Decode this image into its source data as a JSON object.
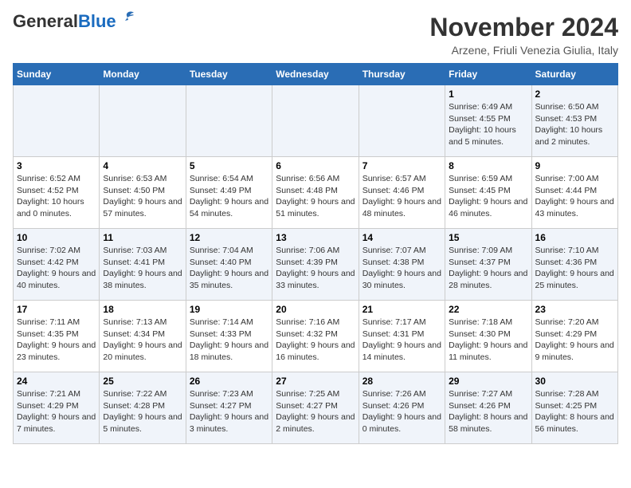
{
  "header": {
    "logo_general": "General",
    "logo_blue": "Blue",
    "month_title": "November 2024",
    "location": "Arzene, Friuli Venezia Giulia, Italy"
  },
  "days_of_week": [
    "Sunday",
    "Monday",
    "Tuesday",
    "Wednesday",
    "Thursday",
    "Friday",
    "Saturday"
  ],
  "weeks": [
    [
      {
        "day": "",
        "info": ""
      },
      {
        "day": "",
        "info": ""
      },
      {
        "day": "",
        "info": ""
      },
      {
        "day": "",
        "info": ""
      },
      {
        "day": "",
        "info": ""
      },
      {
        "day": "1",
        "info": "Sunrise: 6:49 AM\nSunset: 4:55 PM\nDaylight: 10 hours and 5 minutes."
      },
      {
        "day": "2",
        "info": "Sunrise: 6:50 AM\nSunset: 4:53 PM\nDaylight: 10 hours and 2 minutes."
      }
    ],
    [
      {
        "day": "3",
        "info": "Sunrise: 6:52 AM\nSunset: 4:52 PM\nDaylight: 10 hours and 0 minutes."
      },
      {
        "day": "4",
        "info": "Sunrise: 6:53 AM\nSunset: 4:50 PM\nDaylight: 9 hours and 57 minutes."
      },
      {
        "day": "5",
        "info": "Sunrise: 6:54 AM\nSunset: 4:49 PM\nDaylight: 9 hours and 54 minutes."
      },
      {
        "day": "6",
        "info": "Sunrise: 6:56 AM\nSunset: 4:48 PM\nDaylight: 9 hours and 51 minutes."
      },
      {
        "day": "7",
        "info": "Sunrise: 6:57 AM\nSunset: 4:46 PM\nDaylight: 9 hours and 48 minutes."
      },
      {
        "day": "8",
        "info": "Sunrise: 6:59 AM\nSunset: 4:45 PM\nDaylight: 9 hours and 46 minutes."
      },
      {
        "day": "9",
        "info": "Sunrise: 7:00 AM\nSunset: 4:44 PM\nDaylight: 9 hours and 43 minutes."
      }
    ],
    [
      {
        "day": "10",
        "info": "Sunrise: 7:02 AM\nSunset: 4:42 PM\nDaylight: 9 hours and 40 minutes."
      },
      {
        "day": "11",
        "info": "Sunrise: 7:03 AM\nSunset: 4:41 PM\nDaylight: 9 hours and 38 minutes."
      },
      {
        "day": "12",
        "info": "Sunrise: 7:04 AM\nSunset: 4:40 PM\nDaylight: 9 hours and 35 minutes."
      },
      {
        "day": "13",
        "info": "Sunrise: 7:06 AM\nSunset: 4:39 PM\nDaylight: 9 hours and 33 minutes."
      },
      {
        "day": "14",
        "info": "Sunrise: 7:07 AM\nSunset: 4:38 PM\nDaylight: 9 hours and 30 minutes."
      },
      {
        "day": "15",
        "info": "Sunrise: 7:09 AM\nSunset: 4:37 PM\nDaylight: 9 hours and 28 minutes."
      },
      {
        "day": "16",
        "info": "Sunrise: 7:10 AM\nSunset: 4:36 PM\nDaylight: 9 hours and 25 minutes."
      }
    ],
    [
      {
        "day": "17",
        "info": "Sunrise: 7:11 AM\nSunset: 4:35 PM\nDaylight: 9 hours and 23 minutes."
      },
      {
        "day": "18",
        "info": "Sunrise: 7:13 AM\nSunset: 4:34 PM\nDaylight: 9 hours and 20 minutes."
      },
      {
        "day": "19",
        "info": "Sunrise: 7:14 AM\nSunset: 4:33 PM\nDaylight: 9 hours and 18 minutes."
      },
      {
        "day": "20",
        "info": "Sunrise: 7:16 AM\nSunset: 4:32 PM\nDaylight: 9 hours and 16 minutes."
      },
      {
        "day": "21",
        "info": "Sunrise: 7:17 AM\nSunset: 4:31 PM\nDaylight: 9 hours and 14 minutes."
      },
      {
        "day": "22",
        "info": "Sunrise: 7:18 AM\nSunset: 4:30 PM\nDaylight: 9 hours and 11 minutes."
      },
      {
        "day": "23",
        "info": "Sunrise: 7:20 AM\nSunset: 4:29 PM\nDaylight: 9 hours and 9 minutes."
      }
    ],
    [
      {
        "day": "24",
        "info": "Sunrise: 7:21 AM\nSunset: 4:29 PM\nDaylight: 9 hours and 7 minutes."
      },
      {
        "day": "25",
        "info": "Sunrise: 7:22 AM\nSunset: 4:28 PM\nDaylight: 9 hours and 5 minutes."
      },
      {
        "day": "26",
        "info": "Sunrise: 7:23 AM\nSunset: 4:27 PM\nDaylight: 9 hours and 3 minutes."
      },
      {
        "day": "27",
        "info": "Sunrise: 7:25 AM\nSunset: 4:27 PM\nDaylight: 9 hours and 2 minutes."
      },
      {
        "day": "28",
        "info": "Sunrise: 7:26 AM\nSunset: 4:26 PM\nDaylight: 9 hours and 0 minutes."
      },
      {
        "day": "29",
        "info": "Sunrise: 7:27 AM\nSunset: 4:26 PM\nDaylight: 8 hours and 58 minutes."
      },
      {
        "day": "30",
        "info": "Sunrise: 7:28 AM\nSunset: 4:25 PM\nDaylight: 8 hours and 56 minutes."
      }
    ]
  ]
}
